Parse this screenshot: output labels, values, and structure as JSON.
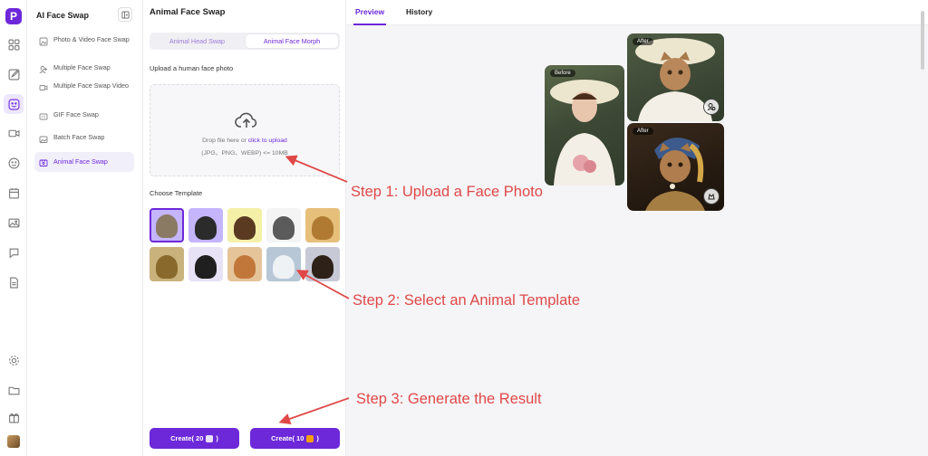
{
  "app": {
    "logo_letter": "P"
  },
  "rail": {
    "icons": [
      "grid-icon",
      "edit-icon",
      "face-swap-icon",
      "video-icon",
      "smile-icon",
      "calendar-icon",
      "image-icon",
      "chat-icon",
      "document-icon",
      "settings-icon",
      "folder-icon",
      "gift-icon"
    ]
  },
  "sidebar": {
    "title": "AI Face Swap",
    "items": [
      {
        "label": "Photo & Video Face Swap",
        "icon": "photo-video-icon"
      },
      {
        "label": "Multiple Face Swap",
        "icon": "users-icon"
      },
      {
        "label": "Multiple Face Swap Video",
        "icon": "video-icon"
      },
      {
        "label": "GIF Face Swap",
        "icon": "gif-icon"
      },
      {
        "label": "Batch Face Swap",
        "icon": "batch-icon"
      },
      {
        "label": "Animal Face Swap",
        "icon": "animal-icon",
        "active": true
      }
    ]
  },
  "panel": {
    "title": "Animal Face Swap",
    "tabs": [
      {
        "label": "Animal Head Swap"
      },
      {
        "label": "Animal Face Morph",
        "active": true
      }
    ],
    "upload_label": "Upload a human face photo",
    "drop_text_prefix": "Drop file here or ",
    "drop_link": "click to upload",
    "drop_formats": "(JPG、PNG、WEBP) <= 10MB",
    "choose_label": "Choose Template",
    "templates": [
      {
        "name": "tabby-cat",
        "bg": "#c4b5fd",
        "fur": "#8a7a63"
      },
      {
        "name": "schnauzer",
        "bg": "#c4b5fd",
        "fur": "#2b2b2b"
      },
      {
        "name": "papillon",
        "bg": "#f5f0a8",
        "fur": "#5a3b22"
      },
      {
        "name": "raccoon",
        "bg": "#f4f4f4",
        "fur": "#5b5b5b"
      },
      {
        "name": "golden-dog",
        "bg": "#e6c07a",
        "fur": "#b07a32"
      },
      {
        "name": "leopard",
        "bg": "#c9b27c",
        "fur": "#8a6a2c"
      },
      {
        "name": "panda",
        "bg": "#e8e2f7",
        "fur": "#1f1f1f"
      },
      {
        "name": "ginger-cat",
        "bg": "#e5c49a",
        "fur": "#c2773a"
      },
      {
        "name": "white-cat",
        "bg": "#b7c7d6",
        "fur": "#eef2f5"
      },
      {
        "name": "rottweiler",
        "bg": "#c7c9d6",
        "fur": "#2e2118"
      }
    ],
    "create_buttons": [
      {
        "label_prefix": "Create( 20",
        "label_suffix": ")"
      },
      {
        "label_prefix": "Create( 10",
        "label_suffix": ")"
      }
    ]
  },
  "right": {
    "tabs": [
      {
        "label": "Preview",
        "active": true
      },
      {
        "label": "History"
      }
    ],
    "photos": [
      {
        "tag": "Before"
      },
      {
        "tag": "After"
      },
      {
        "tag": "After"
      }
    ],
    "annotations": [
      "Step 1: Upload a Face Photo",
      "Step 2: Select an Animal Template",
      "Step 3: Generate the Result"
    ]
  },
  "colors": {
    "accent": "#6d28d9",
    "annotation": "#e04848"
  }
}
